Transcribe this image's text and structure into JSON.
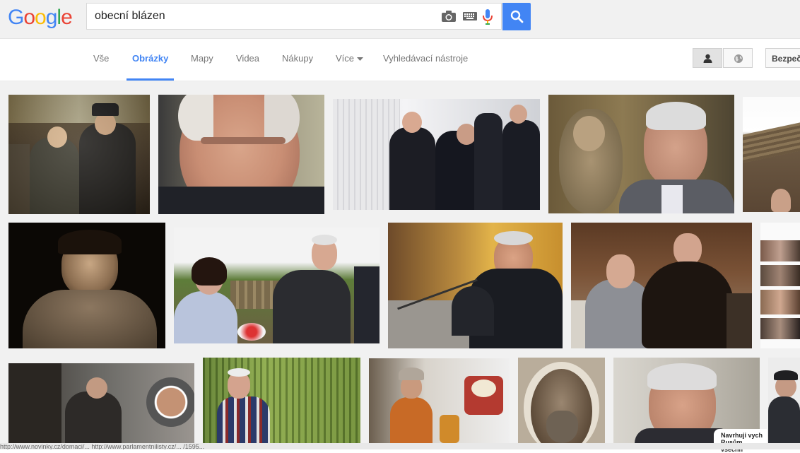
{
  "header": {
    "logo_letters": [
      "G",
      "o",
      "o",
      "g",
      "l",
      "e"
    ],
    "logo_colors": [
      "#4285f4",
      "#ea4335",
      "#fbbc05",
      "#4285f4",
      "#34a853",
      "#ea4335"
    ],
    "search_value": "obecní blázen"
  },
  "tabs": [
    {
      "label": "Vše"
    },
    {
      "label": "Obrázky"
    },
    {
      "label": "Mapy"
    },
    {
      "label": "Videa"
    },
    {
      "label": "Nákupy"
    },
    {
      "label": "Více"
    },
    {
      "label": "Vyhledávací nástroje"
    }
  ],
  "safe_search_label": "Bezpeč",
  "caption_text": "Navrhuji vych Rusům všechn",
  "status_url": "http://www.novinky.cz/domaci/...     http://www.parlamentnilisty.cz/...    /1595...",
  "colors": {
    "accent": "#4285f4",
    "topbar_bg": "#f1f1f1"
  }
}
